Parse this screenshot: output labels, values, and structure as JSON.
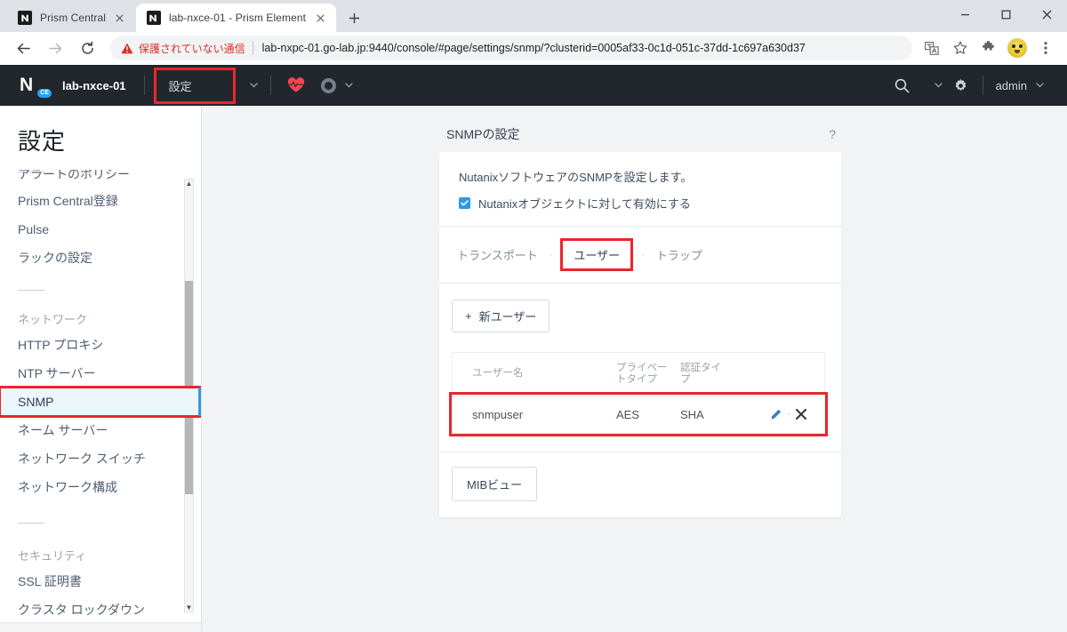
{
  "browser": {
    "tabs": [
      {
        "title": "Prism Central",
        "favicon": "nutanix-n-icon",
        "active": false
      },
      {
        "title": "lab-nxce-01 - Prism Element",
        "favicon": "nutanix-n-icon",
        "active": true
      }
    ],
    "new_tab_label": "+",
    "window_controls": {
      "minimize": "–",
      "maximize": "□",
      "close": "✕"
    },
    "toolbar": {
      "back": "←",
      "forward": "→",
      "reload": "⟳",
      "security_warning": "保護されていない通信",
      "url": "lab-nxpc-01.go-lab.jp:9440/console/#page/settings/snmp/?clusterid=0005af33-0c1d-051c-37dd-1c697a630d37",
      "icons": [
        "translate-icon",
        "bookmark-star-icon",
        "extensions-puzzle-icon",
        "profile-avatar",
        "chrome-menu-icon"
      ]
    }
  },
  "header": {
    "logo_mark": "N",
    "logo_badge": "CE",
    "cluster_name": "lab-nxce-01",
    "menu_label": "設定",
    "health_icon": "heart-pulse-icon",
    "status_icon": "ring-icon",
    "search_icon": "search-icon",
    "help_icon": "question-mark-icon",
    "settings_icon": "gear-icon",
    "user_label": "admin",
    "highlight_color": "#e8272c"
  },
  "sidebar": {
    "title": "設定",
    "clipped_item": "アラートのポリシー",
    "items": [
      {
        "label": "Prism Central登録",
        "type": "item",
        "selected": false
      },
      {
        "label": "Pulse",
        "type": "item",
        "selected": false
      },
      {
        "label": "ラックの設定",
        "type": "item",
        "selected": false
      },
      {
        "label": "ネットワーク",
        "type": "group",
        "selected": false
      },
      {
        "label": "HTTP プロキシ",
        "type": "item",
        "selected": false
      },
      {
        "label": "NTP サーバー",
        "type": "item",
        "selected": false
      },
      {
        "label": "SNMP",
        "type": "item",
        "selected": true
      },
      {
        "label": "ネーム サーバー",
        "type": "item",
        "selected": false
      },
      {
        "label": "ネットワーク スイッチ",
        "type": "item",
        "selected": false
      },
      {
        "label": "ネットワーク構成",
        "type": "item",
        "selected": false
      },
      {
        "label": "セキュリティ",
        "type": "group",
        "selected": false
      },
      {
        "label": "SSL 証明書",
        "type": "item",
        "selected": false
      },
      {
        "label": "クラスタ ロックダウン",
        "type": "item",
        "selected": false
      }
    ],
    "scroll_up_arrow": "▲",
    "scroll_down_arrow": "▼"
  },
  "panel": {
    "title": "SNMPの設定",
    "help_icon_label": "?",
    "intro_text": "NutanixソフトウェアのSNMPを設定します。",
    "checkbox_label": "Nutanixオブジェクトに対して有効にする",
    "checkbox_checked": true,
    "tabs": [
      {
        "label": "トランスポート",
        "active": false,
        "highlighted": false
      },
      {
        "label": "ユーザー",
        "active": true,
        "highlighted": true
      },
      {
        "label": "トラップ",
        "active": false,
        "highlighted": false
      }
    ],
    "tab_separator": "·",
    "new_user_button": {
      "plus": "+",
      "label": "新ユーザー"
    },
    "table": {
      "columns": [
        "ユーザー名",
        "プライベートタイプ",
        "認証タイプ",
        ""
      ],
      "columns_display": [
        {
          "line1": "ユーザー名",
          "line2": ""
        },
        {
          "line1": "プライベー",
          "line2": "トタイプ"
        },
        {
          "line1": "認証タイ",
          "line2": "プ"
        }
      ],
      "rows": [
        {
          "username": "snmpuser",
          "private_type": "AES",
          "auth_type": "SHA",
          "edit_icon": "pencil-icon",
          "separator": "·",
          "delete_icon": "close-x-icon",
          "highlighted": true
        }
      ]
    },
    "mib_button": "MIBビュー"
  }
}
